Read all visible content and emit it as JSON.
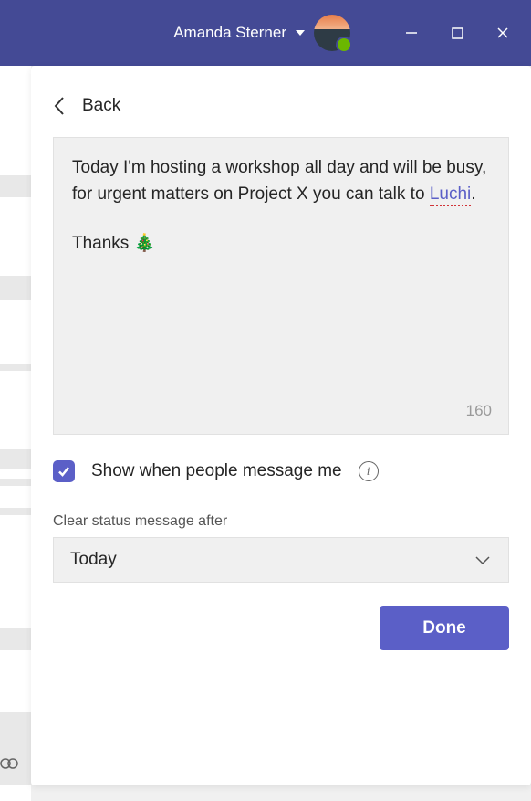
{
  "header": {
    "user_name": "Amanda Sterner"
  },
  "panel": {
    "back_label": "Back",
    "message_text_1": "Today I'm hosting a workshop all day and will be busy, for urgent matters on Project X you can talk to ",
    "mention": "Luchi",
    "message_text_2": ".",
    "message_text_3": "Thanks 🎄",
    "char_count": "160",
    "show_checkbox_label": "Show when people message me",
    "clear_after_label": "Clear status message after",
    "dropdown_value": "Today",
    "done_label": "Done"
  }
}
